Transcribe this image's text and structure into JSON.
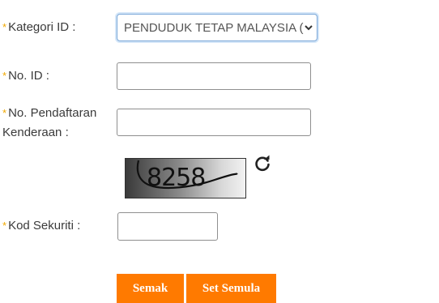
{
  "form": {
    "required_mark": "*",
    "kategori": {
      "label": "Kategori ID :",
      "selected": "PENDUDUK TETAP MALAYSIA (P"
    },
    "no_id": {
      "label": "No. ID :",
      "value": ""
    },
    "no_pendaftaran": {
      "label_line1": "No. Pendaftaran",
      "label_line2": "Kenderaan :",
      "value": ""
    },
    "captcha": {
      "text": "8258"
    },
    "kod_sekuriti": {
      "label": "Kod Sekuriti :",
      "value": ""
    }
  },
  "buttons": {
    "semak": "Semak",
    "set_semula": "Set Semula"
  },
  "colors": {
    "required_star": "#f0a800",
    "button_bg": "#ff7a00",
    "focus_border": "#7aa7d8"
  },
  "icons": {
    "refresh": "refresh-icon",
    "dropdown": "chevron-down-icon"
  }
}
